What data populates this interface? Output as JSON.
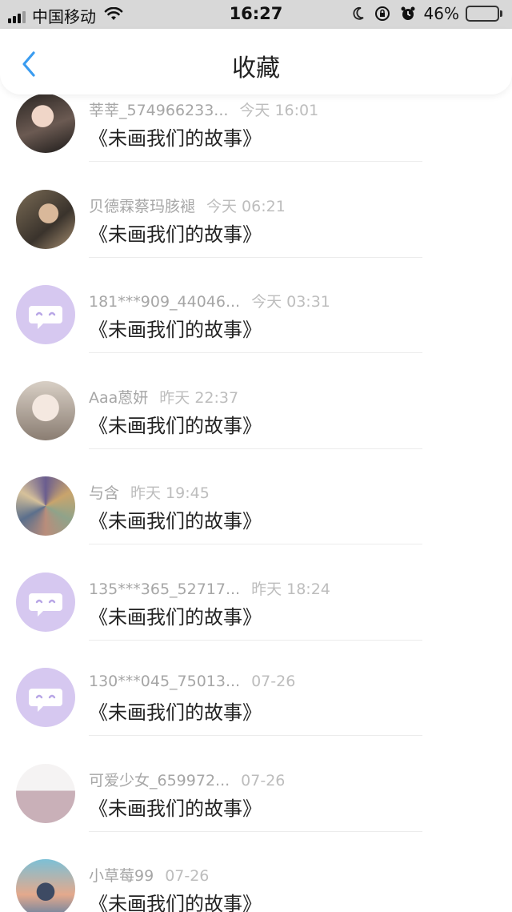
{
  "status_bar": {
    "carrier": "中国移动",
    "time": "16:27",
    "battery_pct": "46%",
    "battery_level": 0.46,
    "battery_color": "#f5c518",
    "icons": [
      "signal-icon",
      "wifi-icon",
      "moon-icon",
      "orientation-lock-icon",
      "alarm-icon",
      "battery-icon"
    ]
  },
  "nav": {
    "title": "收藏",
    "back_icon": "chevron-left-icon",
    "accent": "#3b9cf0"
  },
  "favorites": [
    {
      "user": "莘莘_574966233...",
      "time": "今天 16:01",
      "title": "《未画我们的故事》",
      "avatar": "photo"
    },
    {
      "user": "贝德霖蔡玛胲褪",
      "time": "今天 06:21",
      "title": "《未画我们的故事》",
      "avatar": "photo"
    },
    {
      "user": "181***909_44046...",
      "time": "今天 03:31",
      "title": "《未画我们的故事》",
      "avatar": "default"
    },
    {
      "user": "Aaa蒽妍",
      "time": "昨天 22:37",
      "title": "《未画我们的故事》",
      "avatar": "photo"
    },
    {
      "user": "与含",
      "time": "昨天 19:45",
      "title": "《未画我们的故事》",
      "avatar": "photo"
    },
    {
      "user": "135***365_52717...",
      "time": "昨天 18:24",
      "title": "《未画我们的故事》",
      "avatar": "default"
    },
    {
      "user": "130***045_75013...",
      "time": "07-26",
      "title": "《未画我们的故事》",
      "avatar": "default"
    },
    {
      "user": "可爱少女_659972...",
      "time": "07-26",
      "title": "《未画我们的故事》",
      "avatar": "photo"
    },
    {
      "user": "小草莓99",
      "time": "07-26",
      "title": "《未画我们的故事》",
      "avatar": "photo"
    }
  ]
}
